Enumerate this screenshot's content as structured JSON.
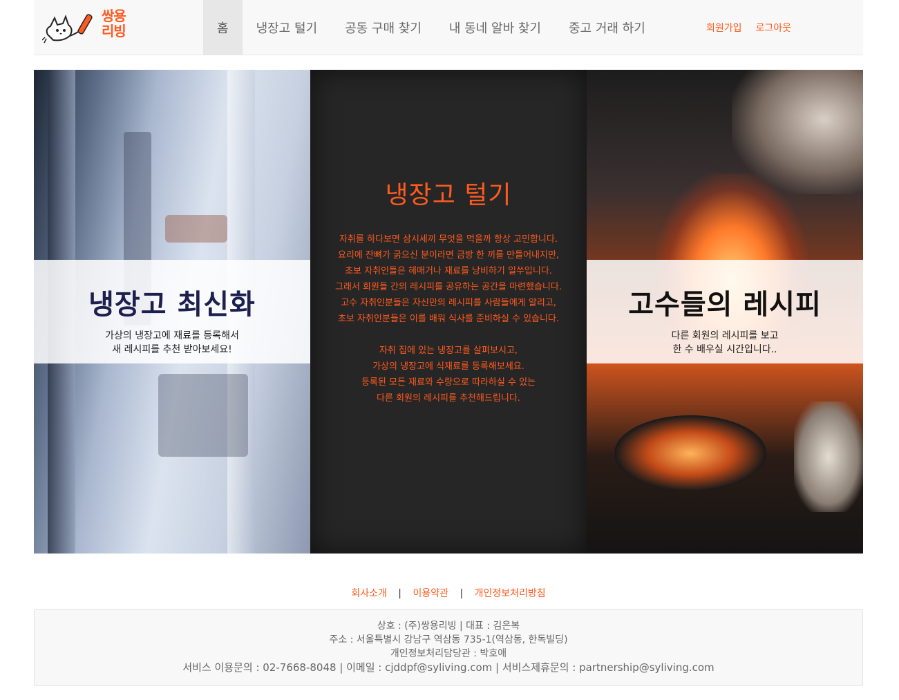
{
  "brand": {
    "logo_line1": "쌍용",
    "logo_line2": "리빙",
    "accent_color": "#ff5a1f"
  },
  "nav": {
    "items": [
      {
        "label": "홈",
        "active": true
      },
      {
        "label": "냉장고 털기",
        "active": false
      },
      {
        "label": "공동 구매 찾기",
        "active": false
      },
      {
        "label": "내 동네 알바 찾기",
        "active": false
      },
      {
        "label": "중고 거래 하기",
        "active": false
      }
    ],
    "signup_label": "회원가입",
    "logout_label": "로그아웃"
  },
  "hero": {
    "left": {
      "title": "냉장고 최신화",
      "sub_line1": "가상의 냉장고에 재료를 등록해서",
      "sub_line2": "새 레시피를 추천 받아보세요!"
    },
    "center": {
      "title": "냉장고 털기",
      "para1": [
        "자취를 하다보면 삼시세끼 무엇을 먹을까 항상 고민합니다.",
        "요리에 잔뼈가 굵으신 분이라면 금방 한 끼를 만들어내지만,",
        "초보 자취인들은 헤매거나 재료를 낭비하기 일쑤입니다.",
        "그래서 회원들 간의 레시피를 공유하는 공간을 마련했습니다.",
        "고수 자취인분들은 자신만의 레시피를 사람들에게 알리고,",
        "초보 자취인분들은 이를 배워 식사를 준비하실 수 있습니다."
      ],
      "para2": [
        "자취 집에 있는 냉장고를 살펴보시고,",
        "가상의 냉장고에 식재료를 등록해보세요.",
        "등록된 모든 재료와 수량으로 따라하실 수 있는",
        "다른 회원의 레시피를 추천해드립니다."
      ]
    },
    "right": {
      "title": "고수들의 레시피",
      "sub_line1": "다른 회원의 레시피를 보고",
      "sub_line2": "한 수 배우실 시간입니다.."
    }
  },
  "footer": {
    "links": [
      "회사소개",
      "이용약관",
      "개인정보처리방침"
    ],
    "company": "상호 : (주)쌍용리빙 | 대표 : 김은복",
    "address": "주소 : 서울특별시 강남구 역삼동 735-1(역삼동, 한독빌딩)",
    "privacy_officer": "개인정보처리담당관 : 박호애",
    "contact": "서비스 이용문의 : 02-7668-8048 | 이메일 : cjddpf@syliving.com | 서비스제휴문의 : partnership@syliving.com"
  }
}
